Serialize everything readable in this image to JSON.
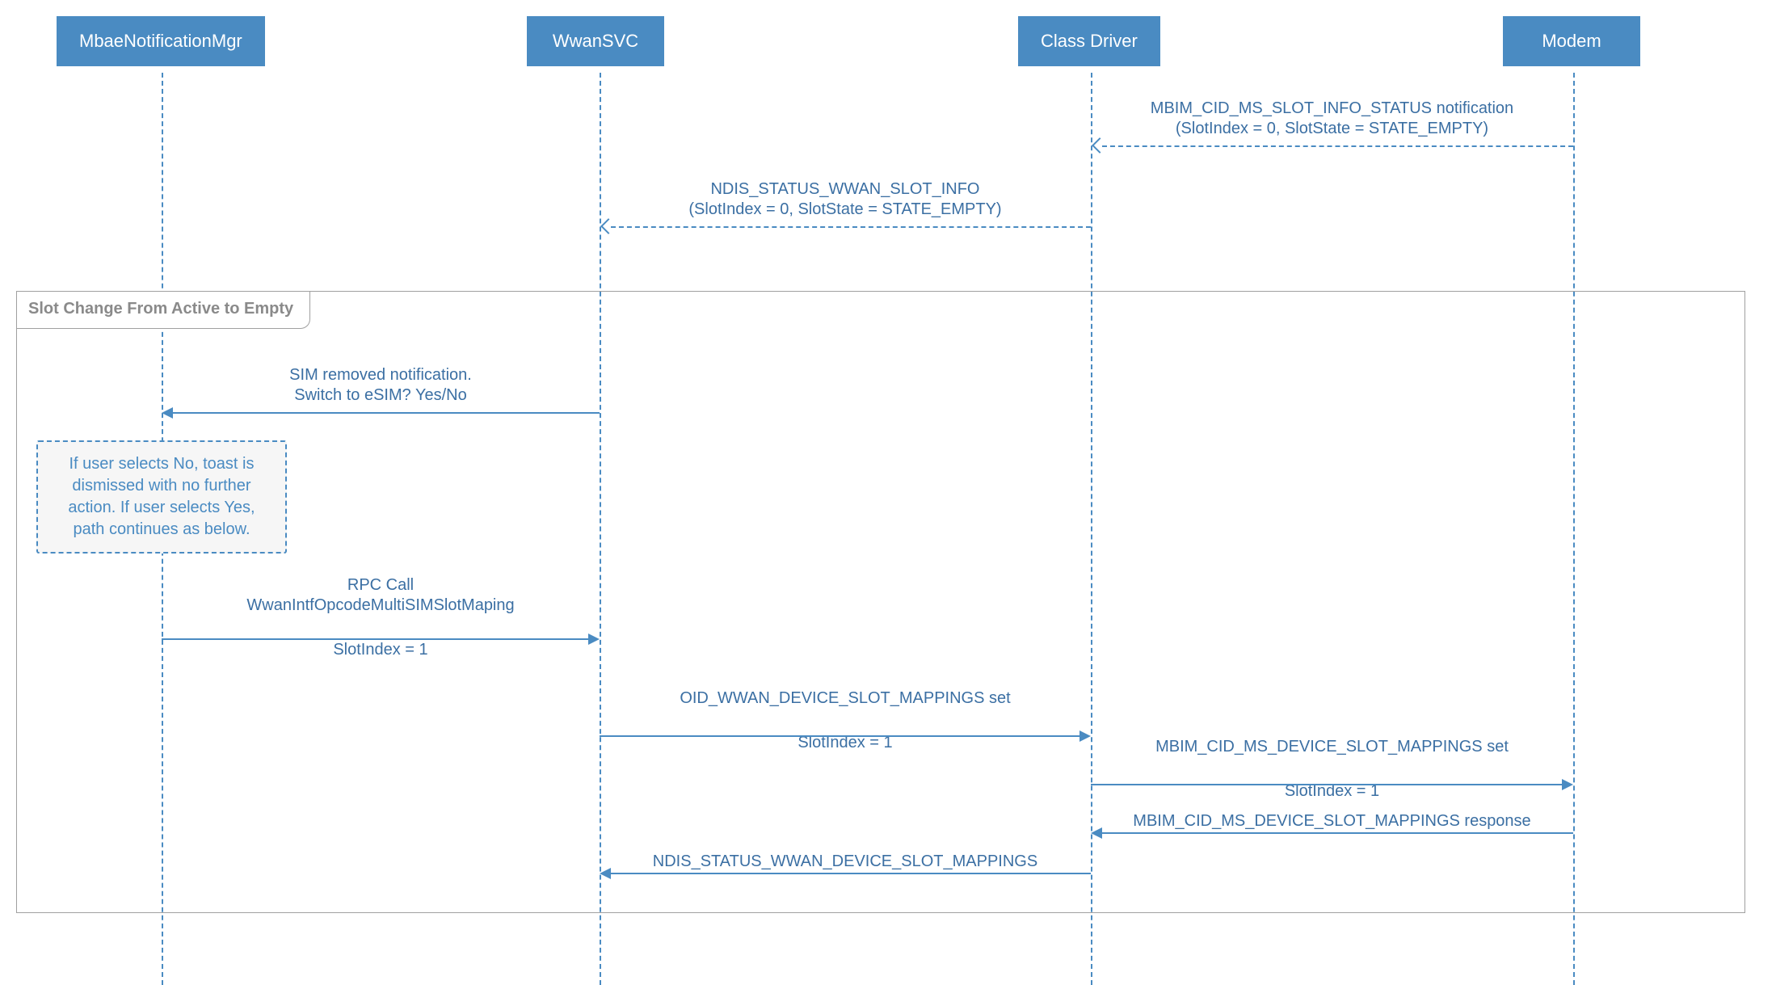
{
  "actors": {
    "mbae": "MbaeNotificationMgr",
    "wwan": "WwanSVC",
    "classdriver": "Class Driver",
    "modem": "Modem"
  },
  "fragment_label": "Slot Change From Active to Empty",
  "note_text": "If user selects No, toast is dismissed with no further action. If user selects Yes, path continues as below.",
  "messages": {
    "m1_l1": "MBIM_CID_MS_SLOT_INFO_STATUS notification",
    "m1_l2": "(SlotIndex = 0, SlotState = STATE_EMPTY)",
    "m2_l1": "NDIS_STATUS_WWAN_SLOT_INFO",
    "m2_l2": "(SlotIndex = 0, SlotState = STATE_EMPTY)",
    "m3_l1": "SIM removed notification.",
    "m3_l2": "Switch to eSIM? Yes/No",
    "m4_l1": "RPC Call",
    "m4_l2": "WwanIntfOpcodeMultiSIMSlotMaping",
    "m4_l3": "SlotIndex = 1",
    "m5_l1": "OID_WWAN_DEVICE_SLOT_MAPPINGS set",
    "m5_l2": "SlotIndex = 1",
    "m6_l1": "MBIM_CID_MS_DEVICE_SLOT_MAPPINGS set",
    "m6_l2": "SlotIndex = 1",
    "m7_l1": "MBIM_CID_MS_DEVICE_SLOT_MAPPINGS response",
    "m8_l1": "NDIS_STATUS_WWAN_DEVICE_SLOT_MAPPINGS"
  },
  "chart_data": {
    "type": "sequence-diagram",
    "actors": [
      "MbaeNotificationMgr",
      "WwanSVC",
      "Class Driver",
      "Modem"
    ],
    "fragment": {
      "label": "Slot Change From Active to Empty",
      "encloses_msg_indices": [
        3,
        4,
        5,
        6,
        7,
        8
      ]
    },
    "messages": [
      {
        "idx": 1,
        "from": "Modem",
        "to": "Class Driver",
        "style": "dashed-open",
        "text": "MBIM_CID_MS_SLOT_INFO_STATUS notification (SlotIndex = 0, SlotState = STATE_EMPTY)"
      },
      {
        "idx": 2,
        "from": "Class Driver",
        "to": "WwanSVC",
        "style": "dashed-open",
        "text": "NDIS_STATUS_WWAN_SLOT_INFO (SlotIndex = 0, SlotState = STATE_EMPTY)"
      },
      {
        "idx": 3,
        "from": "WwanSVC",
        "to": "MbaeNotificationMgr",
        "style": "solid",
        "text": "SIM removed notification. Switch to eSIM? Yes/No"
      },
      {
        "idx": 4,
        "from": "MbaeNotificationMgr",
        "to": "WwanSVC",
        "style": "solid",
        "text": "RPC Call WwanIntfOpcodeMultiSIMSlotMaping SlotIndex = 1"
      },
      {
        "idx": 5,
        "from": "WwanSVC",
        "to": "Class Driver",
        "style": "solid",
        "text": "OID_WWAN_DEVICE_SLOT_MAPPINGS set SlotIndex = 1"
      },
      {
        "idx": 6,
        "from": "Class Driver",
        "to": "Modem",
        "style": "solid",
        "text": "MBIM_CID_MS_DEVICE_SLOT_MAPPINGS set SlotIndex = 1"
      },
      {
        "idx": 7,
        "from": "Modem",
        "to": "Class Driver",
        "style": "solid",
        "text": "MBIM_CID_MS_DEVICE_SLOT_MAPPINGS response"
      },
      {
        "idx": 8,
        "from": "Class Driver",
        "to": "WwanSVC",
        "style": "solid",
        "text": "NDIS_STATUS_WWAN_DEVICE_SLOT_MAPPINGS"
      }
    ],
    "note": {
      "attached_to": "MbaeNotificationMgr",
      "after_msg_idx": 3,
      "text": "If user selects No, toast is dismissed with no further action. If user selects Yes, path continues as below."
    }
  }
}
